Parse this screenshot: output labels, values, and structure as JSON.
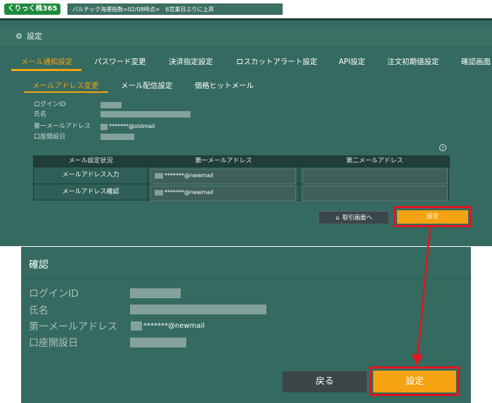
{
  "header": {
    "logo_text": "くりっく株365",
    "ticker": "パルチック海運指数=02/08時点=　6営業日ぶりに上昇"
  },
  "page_title": "設定",
  "main_tabs": [
    {
      "label": "メール通知設定",
      "active": true
    },
    {
      "label": "パスワード変更"
    },
    {
      "label": "決済指定設定"
    },
    {
      "label": "ロスカットアラート設定"
    },
    {
      "label": "API設定"
    },
    {
      "label": "注文初期値設定"
    },
    {
      "label": "確認画面"
    }
  ],
  "sub_tabs": [
    {
      "label": "メールアドレス変更",
      "active": true
    },
    {
      "label": "メール配信設定"
    },
    {
      "label": "価格ヒットメール"
    }
  ],
  "info": {
    "login_id_label": "ログインID",
    "name_label": "氏名",
    "email1_label": "第一メールアドレス",
    "email1_value": "*******@oldmail",
    "open_date_label": "口座開設日"
  },
  "help_icon": "?",
  "table": {
    "headers": [
      "メール設定状況",
      "第一メールアドレス",
      "第二メールアドレス"
    ],
    "rows": [
      {
        "label": "メールアドレス入力",
        "email1": "*******@newmail",
        "email2": ""
      },
      {
        "label": "メールアドレス確認",
        "email1": "*******@newmail",
        "email2": ""
      }
    ]
  },
  "buttons": {
    "home": "取引画面へ",
    "home_icon": "home-icon",
    "set": "設定"
  },
  "confirm": {
    "title": "確認",
    "login_id_label": "ログインID",
    "name_label": "氏名",
    "email1_label": "第一メールアドレス",
    "email1_value": "*******@newmail",
    "open_date_label": "口座開設日",
    "back": "戻る",
    "set": "設定"
  },
  "colors": {
    "panel": "#356a60",
    "accent": "#f5a313",
    "highlight": "#e3141d"
  }
}
